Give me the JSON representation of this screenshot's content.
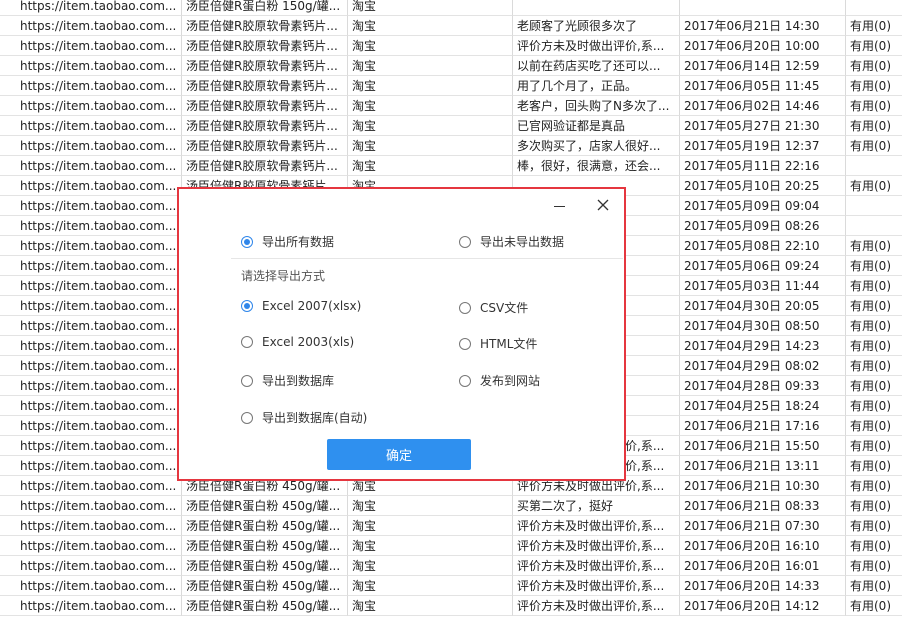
{
  "table": {
    "rows": [
      [
        "https://item.taobao.com...",
        "汤臣倍健R蛋白粉 150g/罐...",
        "淘宝",
        "",
        "",
        ""
      ],
      [
        "https://item.taobao.com...",
        "汤臣倍健R胶原软骨素钙片...",
        "淘宝",
        "老顾客了光顾很多次了",
        "2017年06月21日 14:30",
        "有用(0)"
      ],
      [
        "https://item.taobao.com...",
        "汤臣倍健R胶原软骨素钙片...",
        "淘宝",
        "评价方未及时做出评价,系...",
        "2017年06月20日 10:00",
        "有用(0)"
      ],
      [
        "https://item.taobao.com...",
        "汤臣倍健R胶原软骨素钙片...",
        "淘宝",
        "以前在药店买吃了还可以...",
        "2017年06月14日 12:59",
        "有用(0)"
      ],
      [
        "https://item.taobao.com...",
        "汤臣倍健R胶原软骨素钙片...",
        "淘宝",
        "用了几个月了，正品。",
        "2017年06月05日 11:45",
        "有用(0)"
      ],
      [
        "https://item.taobao.com...",
        "汤臣倍健R胶原软骨素钙片...",
        "淘宝",
        "老客户，回头购了N多次了...",
        "2017年06月02日 14:46",
        "有用(0)"
      ],
      [
        "https://item.taobao.com...",
        "汤臣倍健R胶原软骨素钙片...",
        "淘宝",
        "已官网验证都是真品",
        "2017年05月27日 21:30",
        "有用(0)"
      ],
      [
        "https://item.taobao.com...",
        "汤臣倍健R胶原软骨素钙片...",
        "淘宝",
        "多次购买了，店家人很好...",
        "2017年05月19日 12:37",
        "有用(0)"
      ],
      [
        "https://item.taobao.com...",
        "汤臣倍健R胶原软骨素钙片...",
        "淘宝",
        "棒，很好，很满意，还会...",
        "2017年05月11日 22:16",
        ""
      ],
      [
        "https://item.taobao.com...",
        "汤臣倍健R胶原软骨素钙片...",
        "淘宝",
        "",
        "2017年05月10日 20:25",
        "有用(0)"
      ],
      [
        "https://item.taobao.com...",
        "",
        "",
        "里有...",
        "2017年05月09日 09:04",
        ""
      ],
      [
        "https://item.taobao.com...",
        "",
        "",
        "流也...",
        "2017年05月09日 08:26",
        ""
      ],
      [
        "https://item.taobao.com...",
        "",
        "",
        "",
        "2017年05月08日 22:10",
        "有用(0)"
      ],
      [
        "https://item.taobao.com...",
        "",
        "",
        "给力...",
        "2017年05月06日 09:24",
        "有用(0)"
      ],
      [
        "https://item.taobao.com...",
        "",
        "",
        "",
        "2017年05月03日 11:44",
        "有用(0)"
      ],
      [
        "https://item.taobao.com...",
        "",
        "",
        "多都...",
        "2017年04月30日 20:05",
        "有用(0)"
      ],
      [
        "https://item.taobao.com...",
        "",
        "",
        "子上...",
        "2017年04月30日 08:50",
        "有用(0)"
      ],
      [
        "https://item.taobao.com...",
        "",
        "",
        "",
        "2017年04月29日 14:23",
        "有用(0)"
      ],
      [
        "https://item.taobao.com...",
        "",
        "",
        "个不行",
        "2017年04月29日 08:02",
        "有用(0)"
      ],
      [
        "https://item.taobao.com...",
        "",
        "",
        "比药...",
        "2017年04月28日 09:33",
        "有用(0)"
      ],
      [
        "https://item.taobao.com...",
        "",
        "",
        "效果...",
        "2017年04月25日 18:24",
        "有用(0)"
      ],
      [
        "https://item.taobao.com...",
        "",
        "",
        "待",
        "2017年06月21日 17:16",
        "有用(0)"
      ],
      [
        "https://item.taobao.com...",
        "",
        "",
        "评价方未及时做出评价,系...",
        "2017年06月21日 15:50",
        "有用(0)"
      ],
      [
        "https://item.taobao.com...",
        "",
        "",
        "评价方未及时做出评价,系...",
        "2017年06月21日 13:11",
        "有用(0)"
      ],
      [
        "https://item.taobao.com...",
        "汤臣倍健R蛋白粉 450g/罐...",
        "淘宝",
        "评价方未及时做出评价,系...",
        "2017年06月21日 10:30",
        "有用(0)"
      ],
      [
        "https://item.taobao.com...",
        "汤臣倍健R蛋白粉 450g/罐...",
        "淘宝",
        "买第二次了，挺好",
        "2017年06月21日 08:33",
        "有用(0)"
      ],
      [
        "https://item.taobao.com...",
        "汤臣倍健R蛋白粉 450g/罐...",
        "淘宝",
        "评价方未及时做出评价,系...",
        "2017年06月21日 07:30",
        "有用(0)"
      ],
      [
        "https://item.taobao.com...",
        "汤臣倍健R蛋白粉 450g/罐...",
        "淘宝",
        "评价方未及时做出评价,系...",
        "2017年06月20日 16:10",
        "有用(0)"
      ],
      [
        "https://item.taobao.com...",
        "汤臣倍健R蛋白粉 450g/罐...",
        "淘宝",
        "评价方未及时做出评价,系...",
        "2017年06月20日 16:01",
        "有用(0)"
      ],
      [
        "https://item.taobao.com...",
        "汤臣倍健R蛋白粉 450g/罐...",
        "淘宝",
        "评价方未及时做出评价,系...",
        "2017年06月20日 14:33",
        "有用(0)"
      ],
      [
        "https://item.taobao.com...",
        "汤臣倍健R蛋白粉 450g/罐...",
        "淘宝",
        "评价方未及时做出评价,系...",
        "2017年06月20日 14:12",
        "有用(0)"
      ]
    ]
  },
  "dialog": {
    "scope": {
      "all": "导出所有数据",
      "unexported": "导出未导出数据",
      "selected": "all"
    },
    "method_label": "请选择导出方式",
    "methods": {
      "xlsx": "Excel 2007(xlsx)",
      "csv": "CSV文件",
      "xls": "Excel 2003(xls)",
      "html": "HTML文件",
      "database": "导出到数据库",
      "website": "发布到网站",
      "database_auto": "导出到数据库(自动)",
      "selected": "xlsx"
    },
    "confirm_label": "确定",
    "minimize_icon": "minimize-icon",
    "close_icon": "close-icon",
    "border_color": "#e5363f",
    "accent_color": "#2f90ef"
  }
}
